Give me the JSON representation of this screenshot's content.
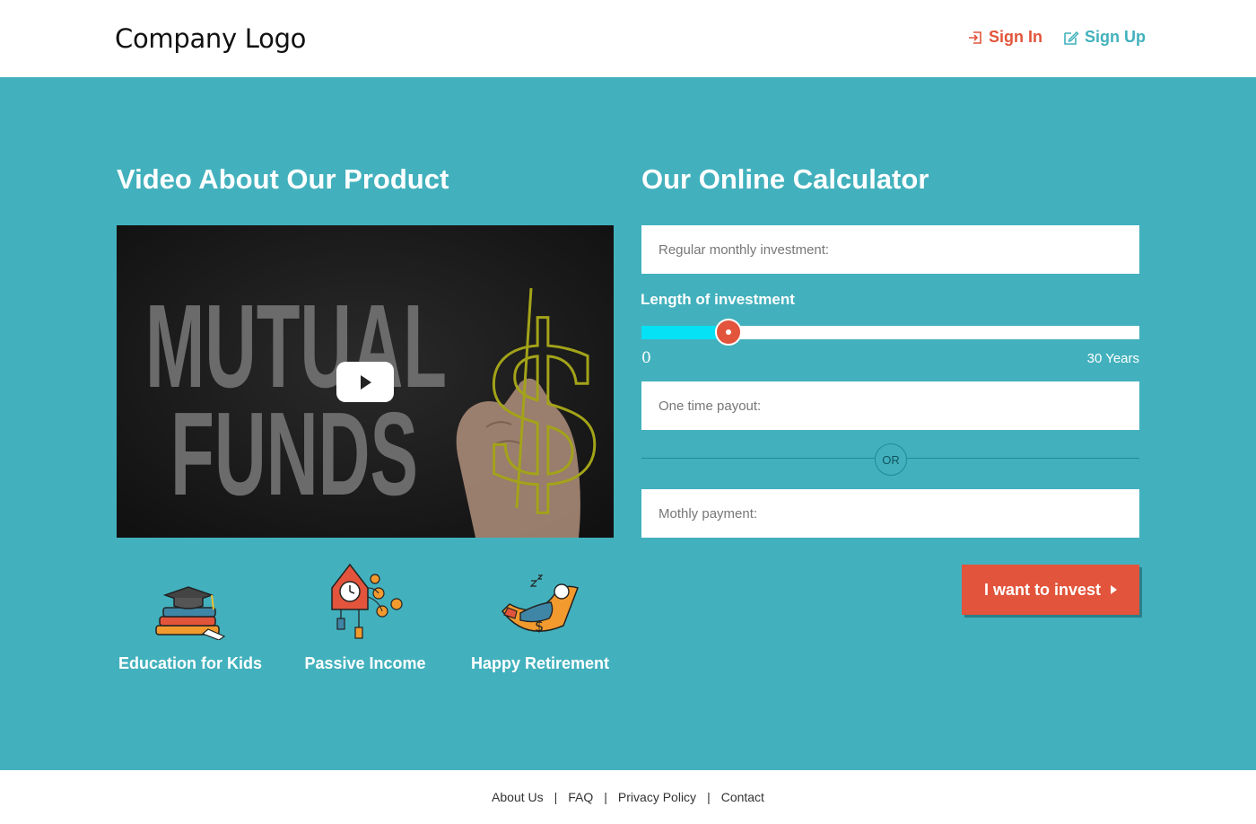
{
  "header": {
    "logo": "Company Logo",
    "sign_in": "Sign In",
    "sign_up": "Sign Up"
  },
  "video": {
    "title": "Video About Our Product",
    "thumbnail_text_line1": "MUTUAL",
    "thumbnail_text_line2": "FUNDS",
    "thumbnail_symbol": "$"
  },
  "features": [
    {
      "label": "Education for Kids",
      "icon": "books-graduation-cap-icon"
    },
    {
      "label": "Passive Income",
      "icon": "money-tree-clock-icon"
    },
    {
      "label": "Happy Retirement",
      "icon": "hammock-relax-icon"
    }
  ],
  "calculator": {
    "title": "Our Online Calculator",
    "monthly_placeholder": "Regular monthly investment:",
    "length_label": "Length of investment",
    "slider_min": "0",
    "slider_max": "30 Years",
    "slider_value_fraction": 0.175,
    "onetime_placeholder": "One time payout:",
    "or_label": "OR",
    "mothly_placeholder": "Mothly payment:",
    "invest_button": "I want to invest"
  },
  "footer": {
    "links": [
      "About Us",
      "FAQ",
      "Privacy Policy",
      "Contact"
    ]
  },
  "colors": {
    "teal": "#42b1bd",
    "accent_red": "#e2543b",
    "slider_fill": "#06e2f5"
  }
}
